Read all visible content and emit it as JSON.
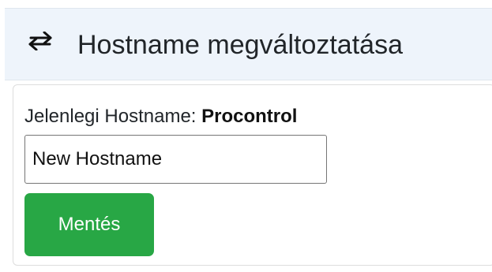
{
  "header": {
    "icon": "swap-arrows-icon",
    "title": "Hostname megváltoztatása",
    "background": "#eef4fb"
  },
  "form": {
    "current_label": "Jelenlegi Hostname:",
    "current_value": "Procontrol",
    "hostname_input": {
      "value": "",
      "placeholder": "New Hostname"
    },
    "save_label": "Mentés",
    "save_color": "#28a745"
  }
}
